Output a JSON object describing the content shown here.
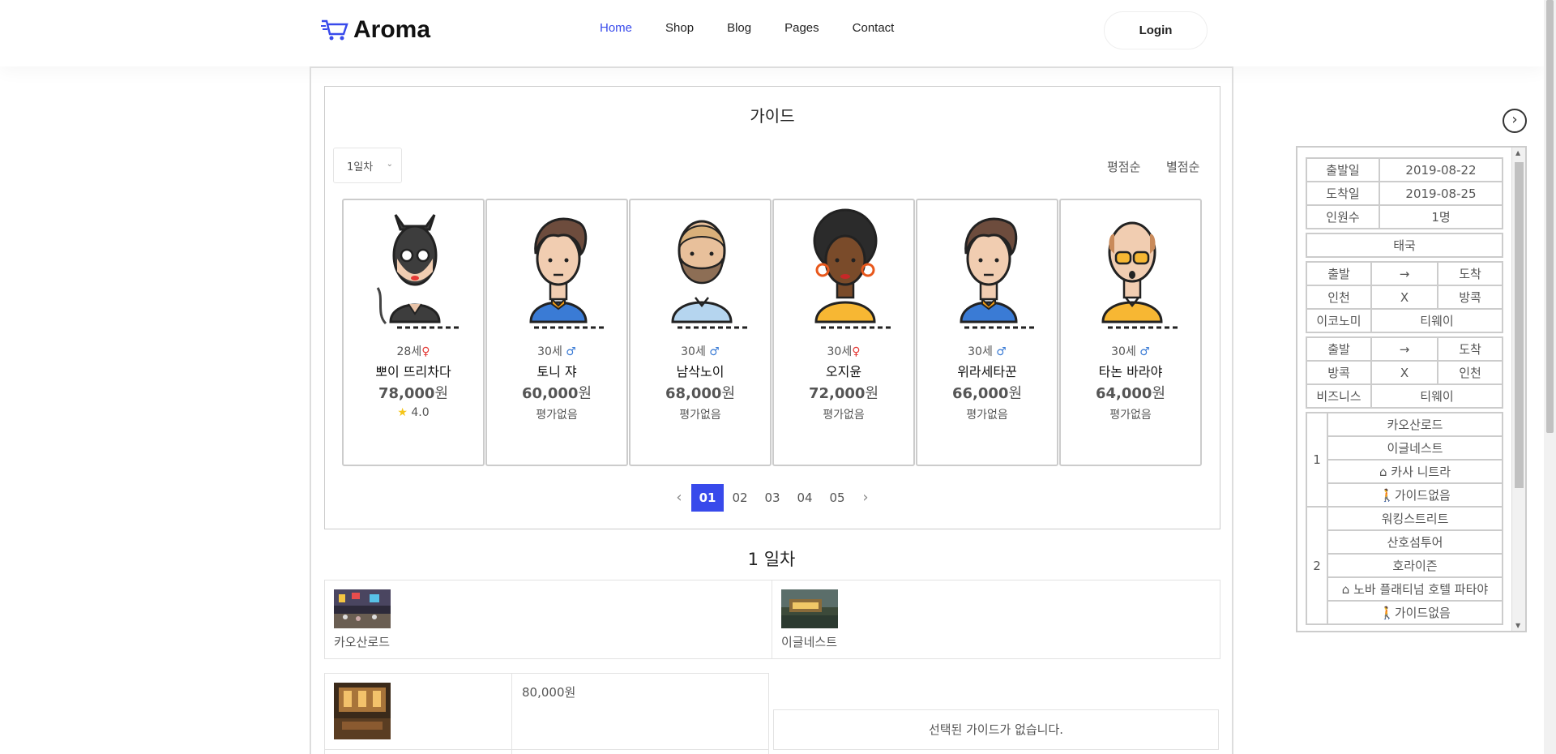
{
  "header": {
    "logo": "Aroma",
    "nav": [
      "Home",
      "Shop",
      "Blog",
      "Pages",
      "Contact"
    ],
    "login": "Login"
  },
  "guide": {
    "title": "가이드",
    "day_select": "1일차",
    "sort_rating": "평점순",
    "sort_star": "별점순",
    "cards": [
      {
        "age": "28세",
        "gender": "♀",
        "name": "뽀이 뜨리차다",
        "price": "78,000",
        "won": "원",
        "rating": "4.0",
        "star": "★"
      },
      {
        "age": "30세",
        "gender": "♂",
        "name": "토니 쟈",
        "price": "60,000",
        "won": "원",
        "rating": "평가없음"
      },
      {
        "age": "30세",
        "gender": "♂",
        "name": "남삭노이",
        "price": "68,000",
        "won": "원",
        "rating": "평가없음"
      },
      {
        "age": "30세",
        "gender": "♀",
        "name": "오지윤",
        "price": "72,000",
        "won": "원",
        "rating": "평가없음"
      },
      {
        "age": "30세",
        "gender": "♂",
        "name": "위라세타꾼",
        "price": "66,000",
        "won": "원",
        "rating": "평가없음"
      },
      {
        "age": "30세",
        "gender": "♂",
        "name": "타논 바라야",
        "price": "64,000",
        "won": "원",
        "rating": "평가없음"
      }
    ],
    "pages": [
      "01",
      "02",
      "03",
      "04",
      "05"
    ],
    "prev": "‹",
    "next": "›"
  },
  "day": {
    "heading": "1 일차",
    "places": [
      "카오산로드",
      "이글네스트"
    ],
    "hotel_price": "80,000원",
    "no_guide": "선택된 가이드가 없습니다."
  },
  "panel": {
    "toggle": "›",
    "info": [
      {
        "label": "출발일",
        "value": "2019-08-22"
      },
      {
        "label": "도착일",
        "value": "2019-08-25"
      },
      {
        "label": "인원수",
        "value": "1명"
      }
    ],
    "country": "태국",
    "flight1": {
      "h1": "출발",
      "arrow": "→",
      "h2": "도착",
      "from": "인천",
      "x": "X",
      "to": "방콕",
      "cls": "이코노미",
      "airline": "티웨이"
    },
    "flight2": {
      "h1": "출발",
      "arrow": "→",
      "h2": "도착",
      "from": "방콕",
      "x": "X",
      "to": "인천",
      "cls": "비즈니스",
      "airline": "티웨이"
    },
    "days": [
      {
        "num": "1",
        "items": [
          "카오산로드",
          "이글네스트"
        ],
        "hotel": "카사 니트라",
        "guide": "가이드없음"
      },
      {
        "num": "2",
        "items": [
          "워킹스트리트",
          "산호섬투어",
          "호라이즌"
        ],
        "hotel": "노바 플래티넘 호텔 파타야",
        "guide": "가이드없음"
      }
    ]
  },
  "colors": {
    "accent": "#384aeb",
    "border": "#cccccc"
  }
}
